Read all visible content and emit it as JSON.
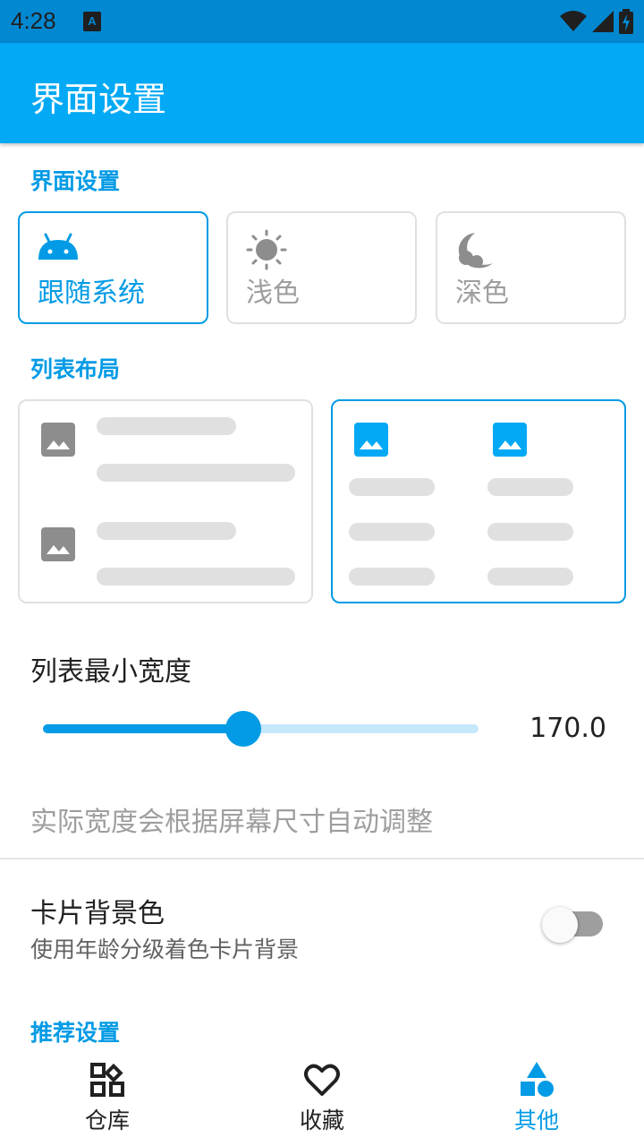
{
  "status_bar": {
    "time": "4:28"
  },
  "app_bar": {
    "title": "界面设置"
  },
  "sections": {
    "interface": "界面设置",
    "list_layout": "列表布局",
    "recommend": "推荐设置"
  },
  "theme_options": [
    {
      "label": "跟随系统",
      "icon": "android-icon",
      "selected": true
    },
    {
      "label": "浅色",
      "icon": "sun-icon",
      "selected": false
    },
    {
      "label": "深色",
      "icon": "moon-icon",
      "selected": false
    }
  ],
  "layout_options": [
    {
      "name": "list-layout",
      "selected": false
    },
    {
      "name": "grid-layout",
      "selected": true
    }
  ],
  "min_width": {
    "title": "列表最小宽度",
    "value": "170.0",
    "slider_fraction": 0.46,
    "hint": "实际宽度会根据屏幕尺寸自动调整"
  },
  "card_bg": {
    "title": "卡片背景色",
    "subtitle": "使用年龄分级着色卡片背景",
    "enabled": false
  },
  "bottom_nav": [
    {
      "label": "仓库",
      "icon": "grid-icon",
      "active": false
    },
    {
      "label": "收藏",
      "icon": "heart-icon",
      "active": false
    },
    {
      "label": "其他",
      "icon": "shapes-icon",
      "active": true
    }
  ],
  "colors": {
    "primary": "#03a9f4",
    "primary_dark": "#0288d1",
    "accent": "#039be5"
  }
}
